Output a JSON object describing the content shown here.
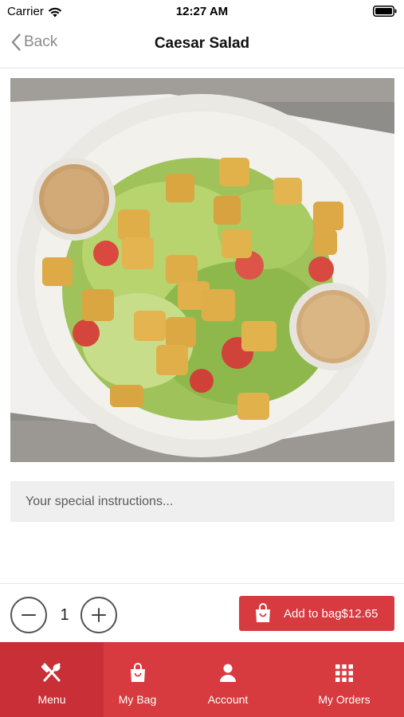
{
  "status_bar": {
    "carrier": "Carrier",
    "time": "12:27 AM"
  },
  "nav": {
    "back_label": "Back",
    "title": "Caesar Salad"
  },
  "product": {
    "image_icon": "caesar-salad-photo"
  },
  "instructions": {
    "placeholder": "Your special instructions...",
    "value": ""
  },
  "quantity": {
    "value": "1"
  },
  "add_to_bag": {
    "label": "Add to bag$12.65"
  },
  "tabs": [
    {
      "label": "Menu",
      "icon": "fork-knife-icon",
      "active": true
    },
    {
      "label": "My Bag",
      "icon": "shopping-bag-icon",
      "active": false
    },
    {
      "label": "Account",
      "icon": "person-icon",
      "active": false
    },
    {
      "label": "My Orders",
      "icon": "grid-icon",
      "active": false
    }
  ],
  "colors": {
    "accent": "#d73a3f",
    "tab_active": "#c92f36"
  }
}
